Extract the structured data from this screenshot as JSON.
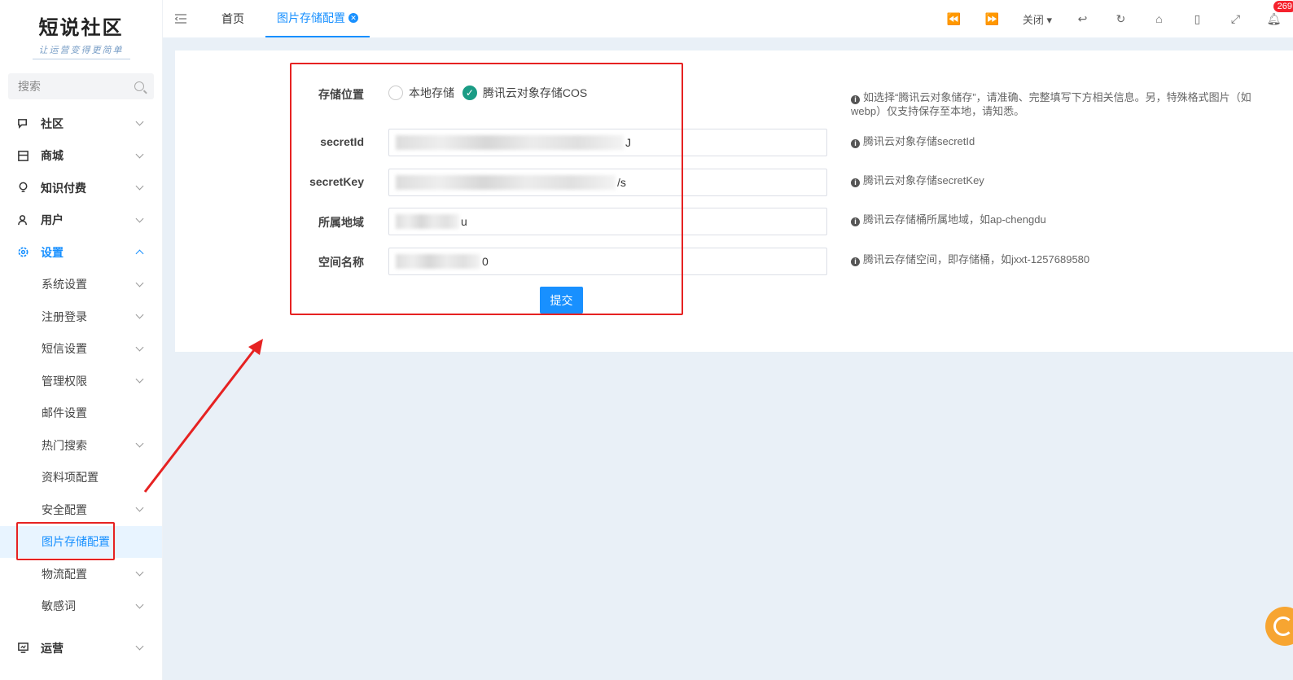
{
  "logo": {
    "title": "短说社区",
    "slogan": "让运营变得更简单"
  },
  "search": {
    "placeholder": "搜索"
  },
  "sidebar": {
    "items": [
      {
        "label": "社区",
        "icon": "chat-icon"
      },
      {
        "label": "商城",
        "icon": "shop-icon"
      },
      {
        "label": "知识付费",
        "icon": "bulb-icon"
      },
      {
        "label": "用户",
        "icon": "users-icon"
      },
      {
        "label": "设置",
        "icon": "gear-icon"
      }
    ],
    "settings_children": [
      {
        "label": "系统设置"
      },
      {
        "label": "注册登录"
      },
      {
        "label": "短信设置"
      },
      {
        "label": "管理权限"
      },
      {
        "label": "邮件设置"
      },
      {
        "label": "热门搜索"
      },
      {
        "label": "资料项配置"
      },
      {
        "label": "安全配置"
      },
      {
        "label": "图片存储配置"
      },
      {
        "label": "物流配置"
      },
      {
        "label": "敏感词"
      }
    ],
    "bottom_item": {
      "label": "运营",
      "icon": "monitor-icon"
    }
  },
  "topbar": {
    "tabs": [
      {
        "label": "首页"
      },
      {
        "label": "图片存储配置"
      }
    ],
    "close_menu": "关闭",
    "notification_count": "269"
  },
  "form": {
    "storage": {
      "label": "存储位置",
      "options": [
        {
          "label": "本地存储",
          "checked": false
        },
        {
          "label": "腾讯云对象存储COS",
          "checked": true
        }
      ],
      "hint": "如选择“腾讯云对象储存”，请准确、完整填写下方相关信息。另，特殊格式图片（如webp）仅支持保存至本地，请知悉。"
    },
    "secret_id": {
      "label": "secretId",
      "value_tail": "J",
      "hint": "腾讯云对象存储secretId"
    },
    "secret_key": {
      "label": "secretKey",
      "value_tail": "/s",
      "hint": "腾讯云对象存储secretKey"
    },
    "region": {
      "label": "所属地域",
      "value_tail": "u",
      "hint": "腾讯云存储桶所属地域，如ap-chengdu"
    },
    "bucket": {
      "label": "空间名称",
      "value_tail": "0",
      "hint": "腾讯云存储空间，即存储桶，如jxxt-1257689580"
    },
    "submit_label": "提交"
  },
  "colors": {
    "accent": "#1890ff",
    "highlight": "#e62222",
    "check": "#1b9c85"
  }
}
